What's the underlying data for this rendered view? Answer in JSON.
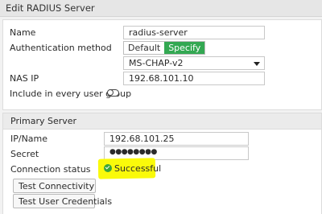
{
  "window": {
    "title": "Edit RADIUS Server"
  },
  "form": {
    "name_label": "Name",
    "name_value": "radius-server",
    "auth_method_label": "Authentication method",
    "auth_default": "Default",
    "auth_specify": "Specify",
    "auth_protocol": "MS-CHAP-v2",
    "nas_ip_label": "NAS IP",
    "nas_ip_value": "192.68.101.10",
    "include_group_label": "Include in every user group",
    "include_group_enabled": false
  },
  "primary_server": {
    "heading": "Primary Server",
    "ip_label": "IP/Name",
    "ip_value": "192.68.101.25",
    "secret_label": "Secret",
    "secret_value": "●●●●●●●●",
    "status_label": "Connection status",
    "status_value": "Successful",
    "status_color": "#3aa53a",
    "highlight_color": "#fafa0a",
    "test_connectivity": "Test Connectivity",
    "test_credentials": "Test User Credentials"
  },
  "colors": {
    "accent": "#33a852"
  }
}
